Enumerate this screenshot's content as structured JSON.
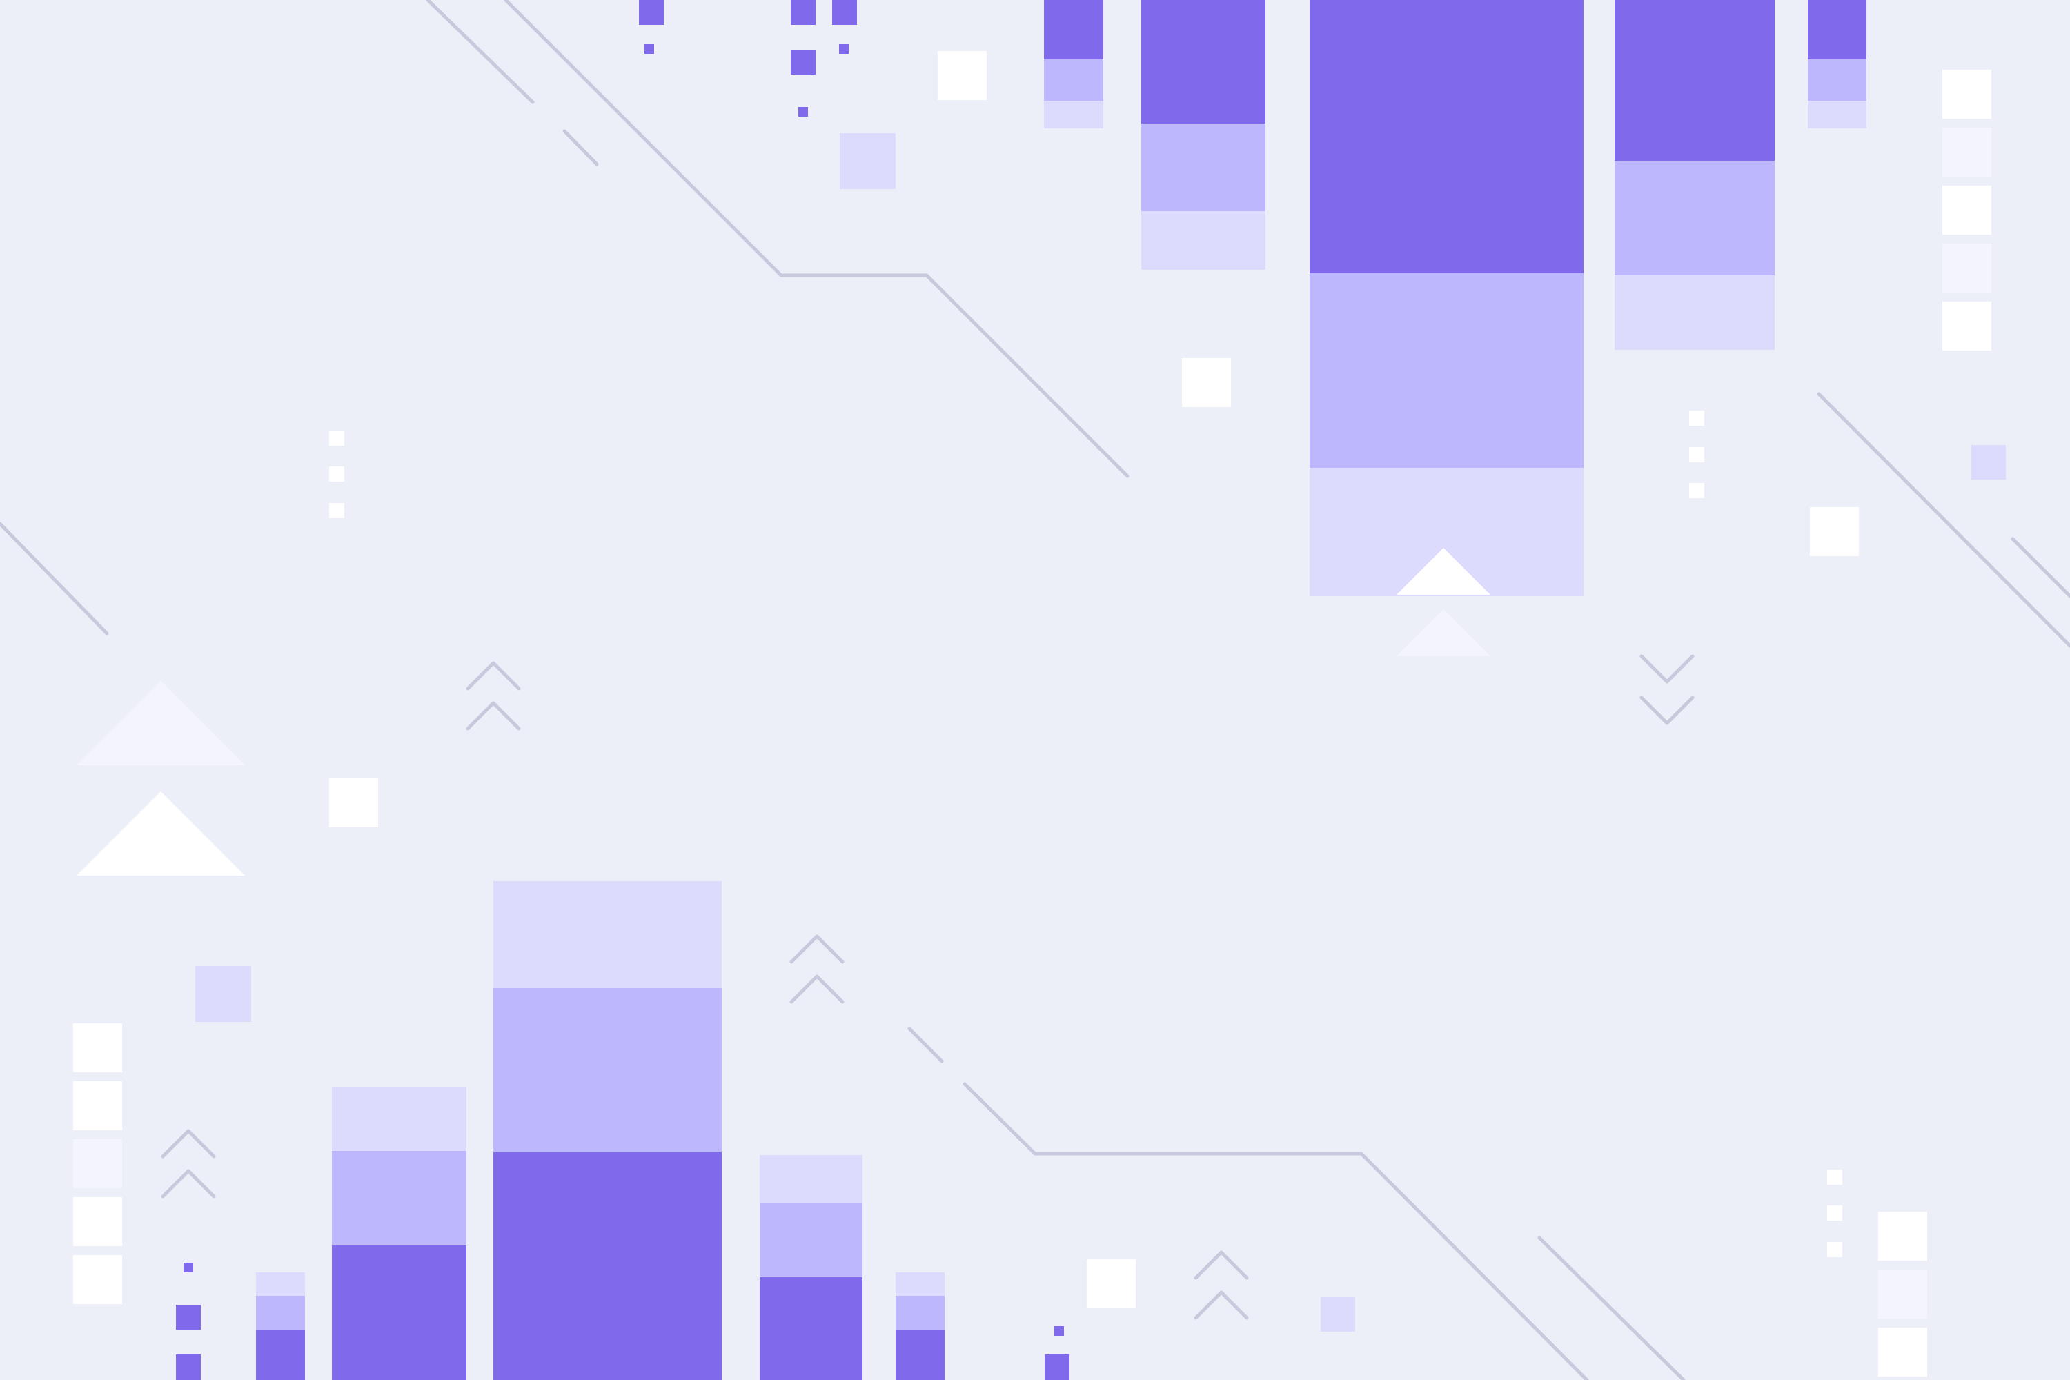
{
  "palette": {
    "background": "#eceef8",
    "purple_dark": "#8069ea",
    "purple_mid": "#bdb7fd",
    "purple_light": "#dcdafd",
    "white": "#ffffff",
    "white_soft": "#f4f4fd",
    "line": "#c8c9dd"
  },
  "decor": {
    "bar_groups": [
      "top-bar-group",
      "bottom-bar-group"
    ],
    "motifs": [
      "double-chevron-up-icon",
      "double-chevron-down-icon",
      "triangle-icon",
      "square-icon",
      "circuit-line"
    ]
  }
}
